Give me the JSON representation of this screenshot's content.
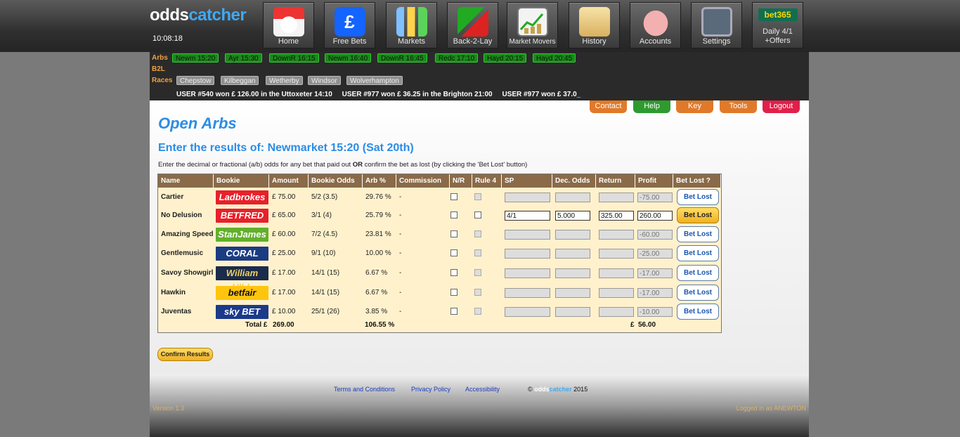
{
  "logo": {
    "part1": "odds",
    "part2": "catcher"
  },
  "clock": "10:08:18",
  "nav": [
    {
      "label": "Home",
      "icon": "home-icon"
    },
    {
      "label": "Free Bets",
      "icon": "pound-icon",
      "glyph": "£"
    },
    {
      "label": "Markets",
      "icon": "bar-chart-icon"
    },
    {
      "label": "Back-2-Lay",
      "icon": "arrows-icon"
    },
    {
      "label": "Market Movers",
      "icon": "trend-icon"
    },
    {
      "label": "History",
      "icon": "scroll-icon"
    },
    {
      "label": "Accounts",
      "icon": "piggy-bank-icon"
    },
    {
      "label": "Settings",
      "icon": "sliders-icon"
    },
    {
      "label_brand": "bet365",
      "label_line1": "Daily 4/1",
      "label_line2": "+Offers",
      "icon": "bet365-logo"
    }
  ],
  "ticker": {
    "arbs_label": "Arbs",
    "arbs": [
      "Newm 15:20",
      "Ayr 15:30",
      "DownR 16:15",
      "Newm 16:40",
      "DownR 16:45",
      "Redc 17:10",
      "Hayd 20:15",
      "Hayd 20:45"
    ],
    "b2l_label": "B2L",
    "races_label": "Races",
    "races": [
      "Chepstow",
      "Kilbeggan",
      "Wetherby",
      "Windsor",
      "Wolverhampton"
    ],
    "scroll": "USER #540 won £ 126.00 in the Uttoxeter 14:10     USER #977 won £ 36.25 in the Brighton 21:00     USER #977 won £ 37.0_"
  },
  "topbuttons": [
    {
      "label": "Contact",
      "color": "#e07a2a"
    },
    {
      "label": "Help",
      "color": "#2f9a2f"
    },
    {
      "label": "Key",
      "color": "#e07a2a"
    },
    {
      "label": "Tools",
      "color": "#e07a2a"
    },
    {
      "label": "Logout",
      "color": "#e0204a"
    }
  ],
  "page_title": "Open Arbs",
  "subtitle": "Enter the results of: Newmarket 15:20 (Sat 20th)",
  "instructions": {
    "pre": "Enter the decimal or fractional (a/b) odds for any bet that paid out ",
    "bold": "OR",
    "post": " confirm the bet as lost (by clicking the 'Bet Lost' button)"
  },
  "table": {
    "headers": [
      "Name",
      "Bookie",
      "Amount",
      "Bookie Odds",
      "Arb %",
      "Commission",
      "N/R",
      "Rule 4",
      "SP",
      "Dec. Odds",
      "Return",
      "Profit",
      "Bet Lost ?"
    ],
    "rows": [
      {
        "name": "Cartier",
        "bookie": "Ladbrokes",
        "bookie_bg": "#e8202a",
        "bookie_fg": "#ffffff",
        "amount": "£ 75.00",
        "odds": "5/2 (3.5)",
        "arb": "29.76 %",
        "commission": "-",
        "sp": "",
        "dec": "",
        "ret": "",
        "profit": "-75.00",
        "btn": "Bet Lost"
      },
      {
        "name": "No Delusion",
        "bookie": "BETFRED",
        "bookie_bg": "#e8202a",
        "bookie_fg": "#ffffff",
        "amount": "£ 65.00",
        "odds": "3/1 (4)",
        "arb": "25.79 %",
        "commission": "-",
        "sp": "4/1",
        "dec": "5.000",
        "ret": "325.00",
        "profit": "260.00",
        "btn": "Bet Lost"
      },
      {
        "name": "Amazing Speed",
        "bookie": "StanJames",
        "bookie_bg": "#62b02a",
        "bookie_fg": "#ffffff",
        "amount": "£ 60.00",
        "odds": "7/2 (4.5)",
        "arb": "23.81 %",
        "commission": "-",
        "sp": "",
        "dec": "",
        "ret": "",
        "profit": "-60.00",
        "btn": "Bet Lost"
      },
      {
        "name": "Gentlemusic",
        "bookie": "CORAL",
        "bookie_bg": "#1a3c82",
        "bookie_fg": "#ffffff",
        "amount": "£ 25.00",
        "odds": "9/1 (10)",
        "arb": "10.00 %",
        "commission": "-",
        "sp": "",
        "dec": "",
        "ret": "",
        "profit": "-25.00",
        "btn": "Bet Lost"
      },
      {
        "name": "Savoy Showgirl",
        "bookie": "William HILL",
        "bookie_bg": "#1b2b4a",
        "bookie_fg": "#f0d060",
        "amount": "£ 17.00",
        "odds": "14/1 (15)",
        "arb": "6.67 %",
        "commission": "-",
        "sp": "",
        "dec": "",
        "ret": "",
        "profit": "-17.00",
        "btn": "Bet Lost"
      },
      {
        "name": "Hawkin",
        "bookie": "betfair",
        "bookie_bg": "#ffc40d",
        "bookie_fg": "#111111",
        "amount": "£ 17.00",
        "odds": "14/1 (15)",
        "arb": "6.67 %",
        "commission": "-",
        "sp": "",
        "dec": "",
        "ret": "",
        "profit": "-17.00",
        "btn": "Bet Lost"
      },
      {
        "name": "Juventas",
        "bookie": "sky BET",
        "bookie_bg": "#1a3a8a",
        "bookie_fg": "#ffffff",
        "amount": "£ 10.00",
        "odds": "25/1 (26)",
        "arb": "3.85 %",
        "commission": "-",
        "sp": "",
        "dec": "",
        "ret": "",
        "profit": "-10.00",
        "btn": "Bet Lost"
      }
    ],
    "total_label": "Total £",
    "total_amount": "269.00",
    "total_arb": "106.55 %",
    "total_profit_label": "£",
    "total_profit": "56.00"
  },
  "confirm_label": "Confirm Results",
  "footer": {
    "links": [
      "Terms and Conditions",
      "Privacy Policy",
      "Accessibility"
    ],
    "copy_prefix": "© ",
    "copy_a": "odds",
    "copy_b": "catcher",
    "copy_year": " 2015",
    "version": "Version 1.3",
    "logged_in": "Logged in as ANEWTON"
  }
}
